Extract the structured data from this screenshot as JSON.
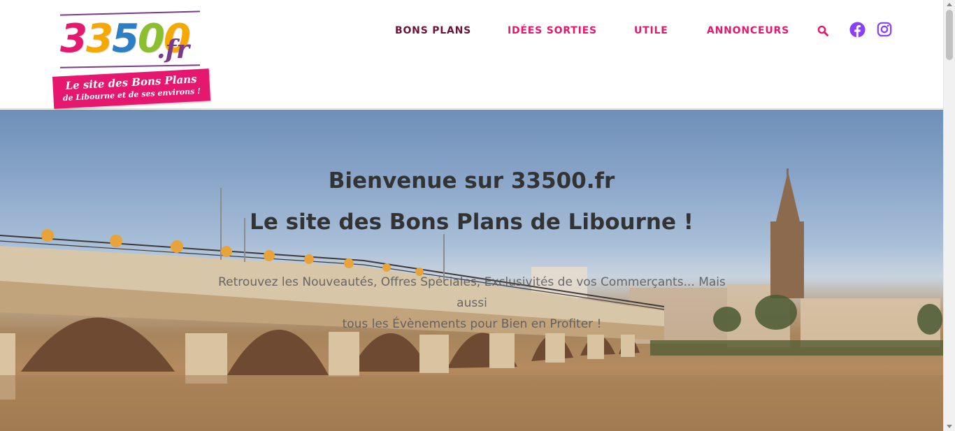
{
  "logo": {
    "digits": [
      "3",
      "3",
      "5",
      "0",
      "0"
    ],
    "digit_colors": [
      "#e5176f",
      "#f5a800",
      "#2c7fc2",
      "#8bbf2e",
      "#f5a800"
    ],
    "tld": ".fr",
    "banner_line1": "Le site des Bons Plans",
    "banner_line2": "de Libourne et de ses environs !"
  },
  "nav": {
    "items": [
      {
        "label": "BONS PLANS",
        "active": true
      },
      {
        "label": "IDÉES SORTIES",
        "active": false
      },
      {
        "label": "UTILE",
        "active": false
      },
      {
        "label": "ANNONCEURS",
        "active": false
      }
    ],
    "icons": [
      "search-icon",
      "facebook-icon",
      "instagram-icon"
    ],
    "colors": {
      "active": "#6b1437",
      "pink": "#e5176f",
      "social": "#8a3ffc"
    }
  },
  "hero": {
    "title1": "Bienvenue sur 33500.fr",
    "title2": "Le site des Bons Plans de Libourne !",
    "subtitle_line1": "Retrouvez les Nouveautés, Offres Spéciales, Exclusivités de vos Commerçants... Mais aussi",
    "subtitle_line2": "tous les Évènements pour Bien en Profiter !"
  }
}
